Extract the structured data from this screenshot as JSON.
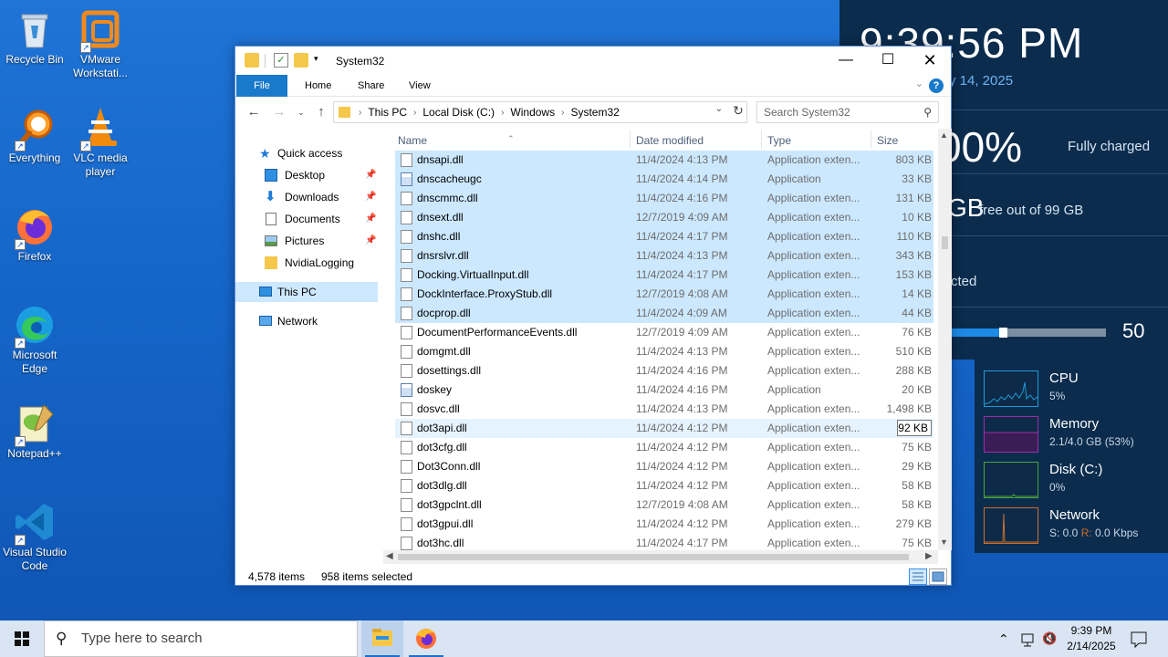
{
  "desktop": {
    "icons": [
      {
        "label": "Recycle Bin"
      },
      {
        "label": "VMware Workstati..."
      },
      {
        "label": "Everything"
      },
      {
        "label": "VLC media player"
      },
      {
        "label": "Firefox"
      },
      {
        "label": "Microsoft Edge"
      },
      {
        "label": "Notepad++"
      },
      {
        "label": "Visual Studio Code"
      }
    ]
  },
  "widget": {
    "clock": "9:39:56 PM",
    "date": "y 14, 2025",
    "battery_big": "00%",
    "battery_text": "Fully charged",
    "disk_big": "GB",
    "disk_text": "free out of 99 GB",
    "network_text": "cted",
    "slider_value": "50",
    "slider_fraction": 0.31
  },
  "perf": {
    "cpu": {
      "name": "CPU",
      "value": "5%",
      "color": "#1f9bd7"
    },
    "memory": {
      "name": "Memory",
      "value": "2.1/4.0 GB (53%)",
      "color": "#9a2fa8"
    },
    "disk": {
      "name": "Disk (C:)",
      "value": "0%",
      "color": "#4aa53a"
    },
    "network": {
      "name": "Network",
      "value_s": "S: 0.0",
      "value_r_label": "R:",
      "value_r": "0.0 Kbps",
      "color": "#c9702b"
    }
  },
  "explorer": {
    "title": "System32",
    "tabs": {
      "file": "File",
      "home": "Home",
      "share": "Share",
      "view": "View"
    },
    "help": "?",
    "breadcrumb": [
      "This PC",
      "Local Disk (C:)",
      "Windows",
      "System32"
    ],
    "search_placeholder": "Search System32",
    "nav": {
      "quick_access": "Quick access",
      "desktop": "Desktop",
      "downloads": "Downloads",
      "documents": "Documents",
      "pictures": "Pictures",
      "nvidia": "NvidiaLogging",
      "this_pc": "This PC",
      "network": "Network"
    },
    "columns": {
      "name": "Name",
      "date": "Date modified",
      "type": "Type",
      "size": "Size"
    },
    "files": [
      {
        "name": "dnsapi.dll",
        "date": "11/4/2024 4:13 PM",
        "type": "Application exten...",
        "size": "803 KB",
        "sel": true,
        "app": false
      },
      {
        "name": "dnscacheugc",
        "date": "11/4/2024 4:14 PM",
        "type": "Application",
        "size": "33 KB",
        "sel": true,
        "app": true
      },
      {
        "name": "dnscmmc.dll",
        "date": "11/4/2024 4:16 PM",
        "type": "Application exten...",
        "size": "131 KB",
        "sel": true,
        "app": false
      },
      {
        "name": "dnsext.dll",
        "date": "12/7/2019 4:09 AM",
        "type": "Application exten...",
        "size": "10 KB",
        "sel": true,
        "app": false
      },
      {
        "name": "dnshc.dll",
        "date": "11/4/2024 4:17 PM",
        "type": "Application exten...",
        "size": "110 KB",
        "sel": true,
        "app": false
      },
      {
        "name": "dnsrslvr.dll",
        "date": "11/4/2024 4:13 PM",
        "type": "Application exten...",
        "size": "343 KB",
        "sel": true,
        "app": false
      },
      {
        "name": "Docking.VirtualInput.dll",
        "date": "11/4/2024 4:17 PM",
        "type": "Application exten...",
        "size": "153 KB",
        "sel": true,
        "app": false
      },
      {
        "name": "DockInterface.ProxyStub.dll",
        "date": "12/7/2019 4:08 AM",
        "type": "Application exten...",
        "size": "14 KB",
        "sel": true,
        "app": false
      },
      {
        "name": "docprop.dll",
        "date": "11/4/2024 4:09 AM",
        "type": "Application exten...",
        "size": "44 KB",
        "sel": true,
        "app": false
      },
      {
        "name": "DocumentPerformanceEvents.dll",
        "date": "12/7/2019 4:09 AM",
        "type": "Application exten...",
        "size": "76 KB",
        "sel": false,
        "app": false
      },
      {
        "name": "domgmt.dll",
        "date": "11/4/2024 4:13 PM",
        "type": "Application exten...",
        "size": "510 KB",
        "sel": false,
        "app": false
      },
      {
        "name": "dosettings.dll",
        "date": "11/4/2024 4:16 PM",
        "type": "Application exten...",
        "size": "288 KB",
        "sel": false,
        "app": false
      },
      {
        "name": "doskey",
        "date": "11/4/2024 4:16 PM",
        "type": "Application",
        "size": "20 KB",
        "sel": false,
        "app": true
      },
      {
        "name": "dosvc.dll",
        "date": "11/4/2024 4:13 PM",
        "type": "Application exten...",
        "size": "1,498 KB",
        "sel": false,
        "app": false
      },
      {
        "name": "dot3api.dll",
        "date": "11/4/2024 4:12 PM",
        "type": "Application exten...",
        "size": "92 KB",
        "sel": false,
        "app": false,
        "hover": true
      },
      {
        "name": "dot3cfg.dll",
        "date": "11/4/2024 4:12 PM",
        "type": "Application exten...",
        "size": "75 KB",
        "sel": false,
        "app": false
      },
      {
        "name": "Dot3Conn.dll",
        "date": "11/4/2024 4:12 PM",
        "type": "Application exten...",
        "size": "29 KB",
        "sel": false,
        "app": false
      },
      {
        "name": "dot3dlg.dll",
        "date": "11/4/2024 4:12 PM",
        "type": "Application exten...",
        "size": "58 KB",
        "sel": false,
        "app": false
      },
      {
        "name": "dot3gpclnt.dll",
        "date": "12/7/2019 4:08 AM",
        "type": "Application exten...",
        "size": "58 KB",
        "sel": false,
        "app": false
      },
      {
        "name": "dot3gpui.dll",
        "date": "11/4/2024 4:12 PM",
        "type": "Application exten...",
        "size": "279 KB",
        "sel": false,
        "app": false
      },
      {
        "name": "dot3hc.dll",
        "date": "11/4/2024 4:17 PM",
        "type": "Application exten...",
        "size": "75 KB",
        "sel": false,
        "app": false
      }
    ],
    "status": {
      "items": "4,578 items",
      "selected": "958 items selected"
    }
  },
  "taskbar": {
    "search_placeholder": "Type here to search",
    "time": "9:39 PM",
    "date": "2/14/2025"
  }
}
